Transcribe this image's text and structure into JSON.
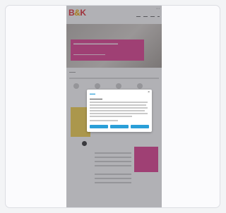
{
  "site": {
    "logo": {
      "part1": "B",
      "part2": "&",
      "part3": "K"
    }
  },
  "colors": {
    "brand_red": "#e1262f",
    "brand_yellow": "#f0a500",
    "hero_pink": "#e13d8f",
    "dialog_accent": "#2a9fd8"
  }
}
